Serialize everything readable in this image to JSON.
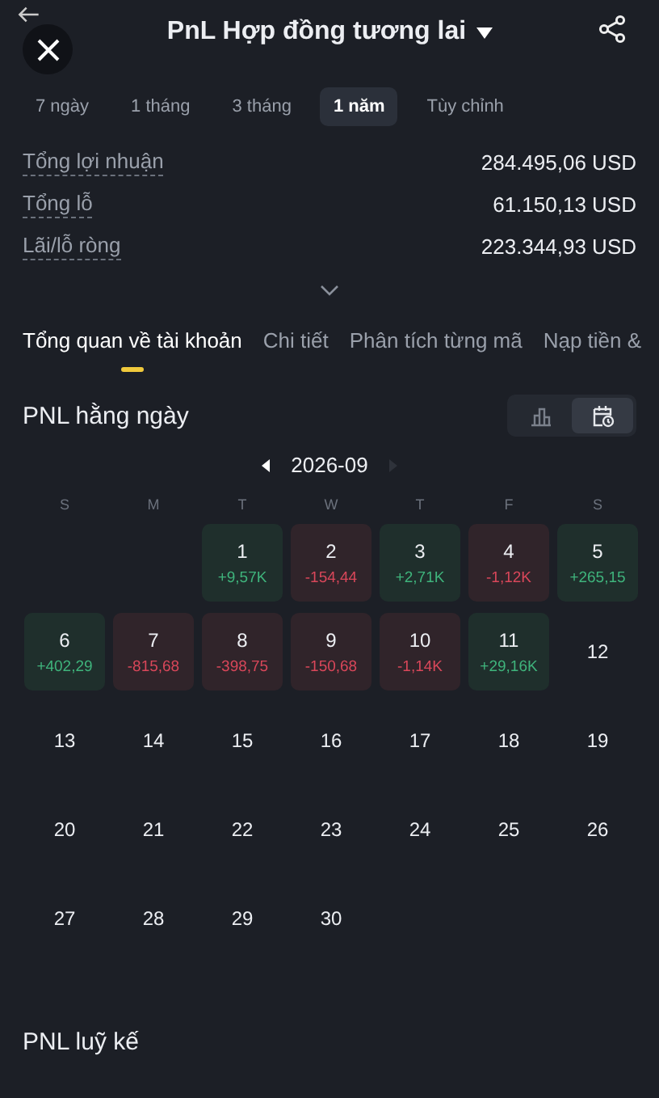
{
  "header": {
    "title": "PnL Hợp đồng tương lai"
  },
  "periods": [
    {
      "label": "7 ngày",
      "selected": false
    },
    {
      "label": "1 tháng",
      "selected": false
    },
    {
      "label": "3 tháng",
      "selected": false
    },
    {
      "label": "1 năm",
      "selected": true
    },
    {
      "label": "Tùy chỉnh",
      "selected": false
    }
  ],
  "summary": [
    {
      "label": "Tổng lợi nhuận",
      "value": "284.495,06 USD"
    },
    {
      "label": "Tổng lỗ",
      "value": "61.150,13 USD"
    },
    {
      "label": "Lãi/lỗ ròng",
      "value": "223.344,93 USD"
    }
  ],
  "sections": [
    {
      "label": "Tổng quan về tài khoản",
      "selected": true
    },
    {
      "label": "Chi tiết",
      "selected": false
    },
    {
      "label": "Phân tích từng mã",
      "selected": false
    },
    {
      "label": "Nạp tiền &",
      "selected": false
    }
  ],
  "daily": {
    "title": "PNL hằng ngày",
    "views": [
      {
        "kind": "bars",
        "selected": false
      },
      {
        "kind": "calendar",
        "selected": true
      }
    ],
    "month": "2026-09",
    "next_disabled": true,
    "weekdays": [
      "S",
      "M",
      "T",
      "W",
      "T",
      "F",
      "S"
    ],
    "cells": [
      {
        "kind": "empty"
      },
      {
        "kind": "empty"
      },
      {
        "kind": "gain",
        "day": "1",
        "value": "+9,57K"
      },
      {
        "kind": "loss",
        "day": "2",
        "value": "-154,44"
      },
      {
        "kind": "gain",
        "day": "3",
        "value": "+2,71K"
      },
      {
        "kind": "loss",
        "day": "4",
        "value": "-1,12K"
      },
      {
        "kind": "gain",
        "day": "5",
        "value": "+265,15"
      },
      {
        "kind": "gain",
        "day": "6",
        "value": "+402,29"
      },
      {
        "kind": "loss",
        "day": "7",
        "value": "-815,68"
      },
      {
        "kind": "loss",
        "day": "8",
        "value": "-398,75"
      },
      {
        "kind": "loss",
        "day": "9",
        "value": "-150,68"
      },
      {
        "kind": "loss",
        "day": "10",
        "value": "-1,14K"
      },
      {
        "kind": "gain",
        "day": "11",
        "value": "+29,16K"
      },
      {
        "kind": "plain",
        "day": "12"
      },
      {
        "kind": "plain",
        "day": "13"
      },
      {
        "kind": "plain",
        "day": "14"
      },
      {
        "kind": "plain",
        "day": "15"
      },
      {
        "kind": "plain",
        "day": "16"
      },
      {
        "kind": "plain",
        "day": "17"
      },
      {
        "kind": "plain",
        "day": "18"
      },
      {
        "kind": "plain",
        "day": "19"
      },
      {
        "kind": "plain",
        "day": "20"
      },
      {
        "kind": "plain",
        "day": "21"
      },
      {
        "kind": "plain",
        "day": "22"
      },
      {
        "kind": "plain",
        "day": "23"
      },
      {
        "kind": "plain",
        "day": "24"
      },
      {
        "kind": "plain",
        "day": "25"
      },
      {
        "kind": "plain",
        "day": "26"
      },
      {
        "kind": "plain",
        "day": "27"
      },
      {
        "kind": "plain",
        "day": "28"
      },
      {
        "kind": "plain",
        "day": "29"
      },
      {
        "kind": "plain",
        "day": "30"
      }
    ]
  },
  "cumulative": {
    "title": "PNL luỹ kế"
  }
}
